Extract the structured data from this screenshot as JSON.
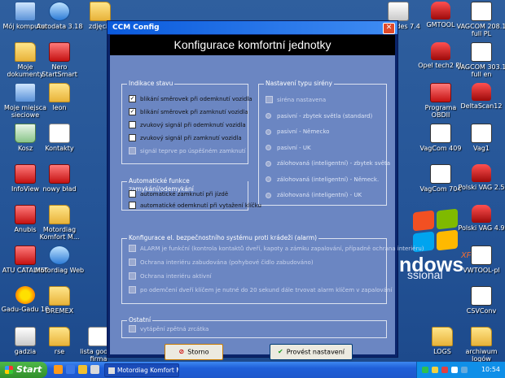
{
  "desktop": {
    "icons": [
      {
        "label": "Mój komputer",
        "kind": "pc"
      },
      {
        "label": "Autodata 3.18",
        "kind": "net"
      },
      {
        "label": "zdjęcia",
        "kind": "folder"
      },
      {
        "label": "Moje dokumenty",
        "kind": "folder"
      },
      {
        "label": "Nero StartSmart",
        "kind": "red"
      },
      {
        "label": "Moje miejsca sieciowe",
        "kind": "pc"
      },
      {
        "label": "leon",
        "kind": "folder"
      },
      {
        "label": "Kosz",
        "kind": "recycle"
      },
      {
        "label": "Kontakty",
        "kind": "doc"
      },
      {
        "label": "InfoView",
        "kind": "red"
      },
      {
        "label": "nowy bład",
        "kind": "red"
      },
      {
        "label": "Anubis",
        "kind": "red"
      },
      {
        "label": "Motordiag Komfort M...",
        "kind": "folder"
      },
      {
        "label": "ATU CATALYST",
        "kind": "red"
      },
      {
        "label": "Motordiag Web",
        "kind": "net"
      },
      {
        "label": "Gadu-Gadu 10",
        "kind": "sun"
      },
      {
        "label": "DREMEX",
        "kind": "folder"
      },
      {
        "label": "gadzia",
        "kind": "app"
      },
      {
        "label": "rse",
        "kind": "folder"
      },
      {
        "label": "lista godzin firma",
        "kind": "doc"
      },
      {
        "label": "Mercedes 7.4",
        "kind": "app"
      },
      {
        "label": "GMTOOL",
        "kind": "car"
      },
      {
        "label": "VAGCOM 208.1 full PL",
        "kind": "vag"
      },
      {
        "label": "Opel tech2 PL",
        "kind": "car"
      },
      {
        "label": "VAGCOM 303.1 full en",
        "kind": "vag"
      },
      {
        "label": "Programa OBDII",
        "kind": "red"
      },
      {
        "label": "DeltaScan12",
        "kind": "car"
      },
      {
        "label": "VagCom 409",
        "kind": "vag"
      },
      {
        "label": "Vag1",
        "kind": "vag"
      },
      {
        "label": "VagCom 704",
        "kind": "vag"
      },
      {
        "label": "Polski VAG 2.5",
        "kind": "car"
      },
      {
        "label": "Polski VAG 4.9",
        "kind": "car"
      },
      {
        "label": "VWTOOL-pl",
        "kind": "vag"
      },
      {
        "label": "CSVConv",
        "kind": "vag"
      },
      {
        "label": "LOGS",
        "kind": "folder"
      },
      {
        "label": "archiwum logów",
        "kind": "folder"
      }
    ],
    "os_logo": {
      "text": "ndows",
      "sub": "ssional",
      "sup": "XP"
    }
  },
  "dialog": {
    "window_title": "CCM Config",
    "close_glyph": "✕",
    "header": "Konfigurace komfortní jednotky",
    "groups": {
      "indikace": {
        "legend": "Indikace stavu",
        "items": [
          {
            "label": "blikání směrovek při odemknutí vozidla",
            "checked": true,
            "enabled": true
          },
          {
            "label": "blikání směrovek při zamknutí vozidla",
            "checked": true,
            "enabled": true
          },
          {
            "label": "zvukový signál při odemknutí vozidla",
            "checked": false,
            "enabled": true
          },
          {
            "label": "zvukový signál při zamknutí vozidla",
            "checked": false,
            "enabled": true
          },
          {
            "label": "signál teprve po úspěšném zamknutí",
            "checked": false,
            "enabled": false
          }
        ]
      },
      "typ_sireny": {
        "legend": "Nastavení typu sirény",
        "top_item": {
          "label": "siréna nastavena",
          "checked": false,
          "enabled": false
        },
        "radios": [
          "pasivní - zbytek světla (standard)",
          "pasivní - Německo",
          "pasivní - UK",
          "zálohovaná (inteligentní) - zbytek světa",
          "zálohovaná (inteligentní) - Německ.",
          "zálohovaná (inteligentní) - UK"
        ]
      },
      "automaticke": {
        "legend": "Automatické funkce zamykání/odemykání",
        "items": [
          {
            "label": "automatické zamknutí při jízdě",
            "checked": false,
            "enabled": true
          },
          {
            "label": "automatické odemknutí při vytažení klíčku",
            "checked": false,
            "enabled": true
          }
        ]
      },
      "bezpecnost": {
        "legend": "Konfigurace el. bezpečnostního systému proti krádeži (alarm)",
        "items": [
          {
            "label": "ALARM je funkční (kontrola kontaktů dveří, kapoty a zámku zapalování, případně ochrana interiéru)",
            "checked": false,
            "enabled": false
          },
          {
            "label": "Ochrana interiéru zabudována (pohybové čidlo zabudováno)",
            "checked": false,
            "enabled": false
          },
          {
            "label": "Ochrana interiéru aktivní",
            "checked": false,
            "enabled": false
          },
          {
            "label": "po odemčení dveří klíčem je nutné do 20 sekund dále trvovat alarm klíčem v zapalování",
            "checked": false,
            "enabled": false
          }
        ]
      },
      "ostatni": {
        "legend": "Ostatní",
        "items": [
          {
            "label": "vytápění zpětná zrcátka",
            "checked": false,
            "enabled": false
          }
        ]
      }
    },
    "buttons": {
      "cancel": "Storno",
      "apply": "Provést nastavení"
    }
  },
  "taskbar": {
    "start_label": "Start",
    "task_item": "Motordiag Komfort M...",
    "clock": "10:54"
  }
}
